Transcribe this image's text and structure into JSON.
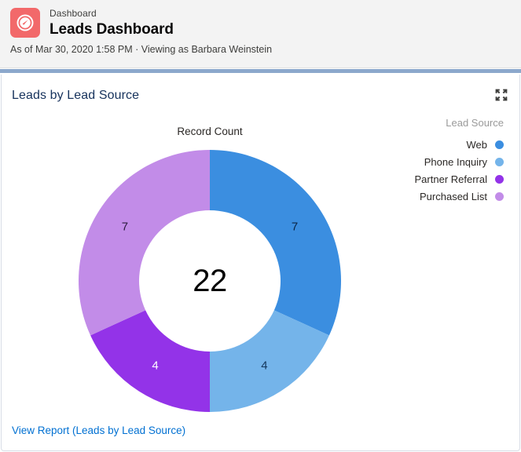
{
  "header": {
    "icon_name": "dashboard-gauge-icon",
    "icon_color": "#f2696a",
    "breadcrumb": "Dashboard",
    "title": "Leads Dashboard",
    "meta": "As of Mar 30, 2020 1:58 PM · Viewing as Barbara Weinstein"
  },
  "card": {
    "title": "Leads by Lead Source",
    "expand_icon": "expand-fullscreen-icon",
    "view_report_label": "View Report (Leads by Lead Source)"
  },
  "legend": {
    "title": "Lead Source"
  },
  "chart_data": {
    "type": "pie",
    "variant": "donut",
    "title": "Leads by Lead Source",
    "measure_label": "Record Count",
    "center_value": "22",
    "total": 22,
    "legend_title": "Lead Source",
    "legend_position": "right",
    "start_angle_deg": 0,
    "direction": "clockwise",
    "categories": [
      "Web",
      "Phone Inquiry",
      "Partner Referral",
      "Purchased List"
    ],
    "values": [
      7,
      4,
      4,
      7
    ],
    "value_labels": [
      "7",
      "4",
      "4",
      "7"
    ],
    "colors": [
      "#3b8ee0",
      "#74b4ea",
      "#9333e8",
      "#c28ce8"
    ],
    "label_colors": [
      "#0b2545",
      "#15375c",
      "#ffffff",
      "#2b1b3d"
    ],
    "slices": [
      {
        "label": "Web",
        "value": 7,
        "color": "#3b8ee0",
        "percent": 31.8
      },
      {
        "label": "Phone Inquiry",
        "value": 4,
        "color": "#74b4ea",
        "percent": 18.2
      },
      {
        "label": "Partner Referral",
        "value": 4,
        "color": "#9333e8",
        "percent": 18.2
      },
      {
        "label": "Purchased List",
        "value": 7,
        "color": "#c28ce8",
        "percent": 31.8
      }
    ]
  }
}
